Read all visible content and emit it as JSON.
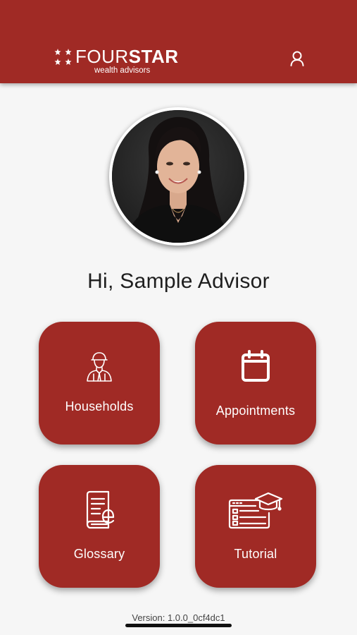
{
  "brand": {
    "name_light": "FOUR",
    "name_bold": "STAR",
    "tagline": "wealth advisors",
    "color": "#a02a25"
  },
  "header": {
    "profile_icon": "user-icon"
  },
  "user": {
    "greeting": "Hi, Sample Advisor"
  },
  "tiles": [
    {
      "label": "Households",
      "icon": "advisor-person-icon"
    },
    {
      "label": "Appointments",
      "icon": "calendar-icon"
    },
    {
      "label": "Glossary",
      "icon": "glossary-book-icon"
    },
    {
      "label": "Tutorial",
      "icon": "tutorial-graduation-icon"
    }
  ],
  "footer": {
    "version": "Version: 1.0.0_0cf4dc1"
  }
}
